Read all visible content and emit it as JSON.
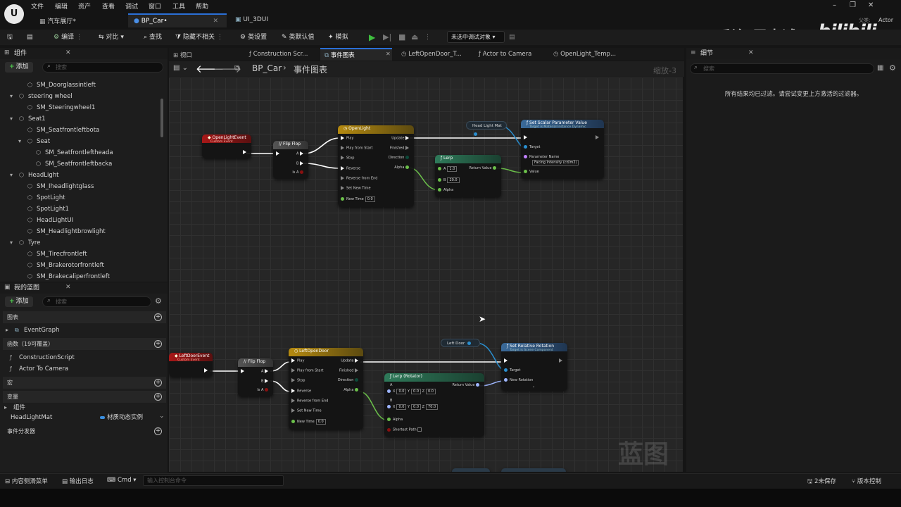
{
  "menu": [
    "文件",
    "编辑",
    "资产",
    "查看",
    "调试",
    "窗口",
    "工具",
    "帮助"
  ],
  "doc_tabs": [
    {
      "label": "汽车展厅*"
    },
    {
      "label": "BP_Car•"
    },
    {
      "label": "UI_3DUI"
    }
  ],
  "window_controls": {
    "minimize": "–",
    "restore": "❐",
    "close": "✕"
  },
  "watermark": {
    "text": "乔治-周士诚",
    "logo": "bilibili",
    "actor": "Actor",
    "small": "父类:"
  },
  "toolbar": {
    "compile": "编译",
    "diff": "对比",
    "find": "查找",
    "hide_unrelated": "隐藏不相关",
    "class_settings": "类设置",
    "class_defaults": "类默认值",
    "simulate": "模拟",
    "debug_object": "未选中调试对象"
  },
  "components_panel": {
    "title": "组件",
    "add": "添加",
    "search_placeholder": "搜索",
    "items": [
      {
        "label": "SM_Doorglassintleft",
        "indent": 2
      },
      {
        "label": "steering wheel",
        "indent": 1
      },
      {
        "label": "SM_Steeringwheel1",
        "indent": 2
      },
      {
        "label": "Seat1",
        "indent": 1
      },
      {
        "label": "SM_Seatfrontleftbota",
        "indent": 2
      },
      {
        "label": "Seat",
        "indent": 2
      },
      {
        "label": "SM_Seatfrontleftheada",
        "indent": 3
      },
      {
        "label": "SM_Seatfrontleftbacka",
        "indent": 3
      },
      {
        "label": "HeadLight",
        "indent": 1
      },
      {
        "label": "SM_Iheadlightglass",
        "indent": 2
      },
      {
        "label": "SpotLight",
        "indent": 2
      },
      {
        "label": "SpotLight1",
        "indent": 2
      },
      {
        "label": "HeadLightUI",
        "indent": 2
      },
      {
        "label": "SM_Headlightbrowlight",
        "indent": 2
      },
      {
        "label": "Tyre",
        "indent": 1
      },
      {
        "label": "SM_Tirecfrontleft",
        "indent": 2
      },
      {
        "label": "SM_Brakerotorfrontleft",
        "indent": 2
      },
      {
        "label": "SM_Brakecaliperfrontleft",
        "indent": 2
      }
    ]
  },
  "blueprint_panel": {
    "title": "我的蓝图",
    "add": "添加",
    "search_placeholder": "搜索",
    "graphs_head": "图表",
    "event_graph": "EventGraph",
    "functions_head": "函数（19可覆盖）",
    "functions": [
      "ConstructionScript",
      "Actor To Camera"
    ],
    "macros_head": "宏",
    "variables_head": "变量",
    "components_sub": "组件",
    "variable_name": "HeadLightMat",
    "variable_type": "材质动态实例",
    "dispatchers_head": "事件分发器"
  },
  "editor_tabs": [
    {
      "label": "视口"
    },
    {
      "label": "Construction Scr..."
    },
    {
      "label": "事件图表"
    },
    {
      "label": "LeftOpenDoor_T..."
    },
    {
      "label": "Actor to Camera"
    },
    {
      "label": "OpenLight_Temp..."
    }
  ],
  "breadcrumb": {
    "blueprint": "BP_Car",
    "graph": "事件图表",
    "zoom": "缩放-3"
  },
  "graph": {
    "watermark": "蓝图",
    "nodes": {
      "open_light_event": {
        "title": "OpenLightEvent",
        "sub": "Custom Event"
      },
      "flip_flop_1": {
        "title": "Flip Flop",
        "a": "A",
        "b": "B",
        "is_a": "Is A"
      },
      "open_light_tl": {
        "title": "OpenLight",
        "play": "Play",
        "play_from_start": "Play from Start",
        "stop": "Stop",
        "reverse": "Reverse",
        "reverse_from_end": "Reverse from End",
        "set_new_time": "Set New Time",
        "new_time": "New Time",
        "new_time_val": "0.0",
        "update": "Update",
        "finished": "Finished",
        "direction": "Direction",
        "alpha": "Alpha"
      },
      "head_light_mat": {
        "title": "Head Light Mat"
      },
      "set_scalar": {
        "title": "Set Scalar Parameter Value",
        "sub": "Target is Material Instance Dynamic",
        "target": "Target",
        "param_name": "Parameter Name",
        "param_val": "Facing Intensity (cd/m2)",
        "value": "Value"
      },
      "lerp": {
        "title": "Lerp",
        "a": "A",
        "a_val": "1.0",
        "b": "B",
        "b_val": "20.0",
        "alpha": "Alpha",
        "return": "Return Value"
      },
      "left_door_event": {
        "title": "LeftDoorEvent",
        "sub": "Custom Event"
      },
      "flip_flop_2": {
        "title": "Flip Flop",
        "a": "A",
        "b": "B",
        "is_a": "Is A"
      },
      "left_open_door_tl": {
        "title": "LeftOpenDoor",
        "play": "Play",
        "play_from_start": "Play from Start",
        "stop": "Stop",
        "reverse": "Reverse",
        "reverse_from_end": "Reverse from End",
        "set_new_time": "Set New Time",
        "new_time": "New Time",
        "new_time_val": "0.0",
        "update": "Update",
        "finished": "Finished",
        "direction": "Direction",
        "alpha": "Alpha"
      },
      "left_door": {
        "title": "Left Door"
      },
      "set_rel_rot": {
        "title": "Set Relative Rotation",
        "sub": "Target is Scene Component",
        "target": "Target",
        "new_rotation": "New Rotation"
      },
      "lerp_rot": {
        "title": "Lerp (Rotator)",
        "a": "A",
        "b": "B",
        "a_x": "0.0",
        "a_y": "0.0",
        "a_z": "0.0",
        "b_x": "0.0",
        "b_y": "0.0",
        "b_z": "70.0",
        "alpha": "Alpha",
        "shortest": "Shortest Path",
        "return": "Return Value",
        "x": "X",
        "y": "Y",
        "z": "Z"
      }
    }
  },
  "details_panel": {
    "title": "细节",
    "search_placeholder": "搜索",
    "empty_msg": "所有结果均已过滤。请尝试变更上方激活的过滤器。"
  },
  "statusbar": {
    "content_drawer": "内容侧滑菜单",
    "output_log": "输出日志",
    "cmd": "Cmd",
    "cmd_placeholder": "输入控制台命令",
    "unsaved": "2未保存",
    "source_control": "版本控制"
  }
}
